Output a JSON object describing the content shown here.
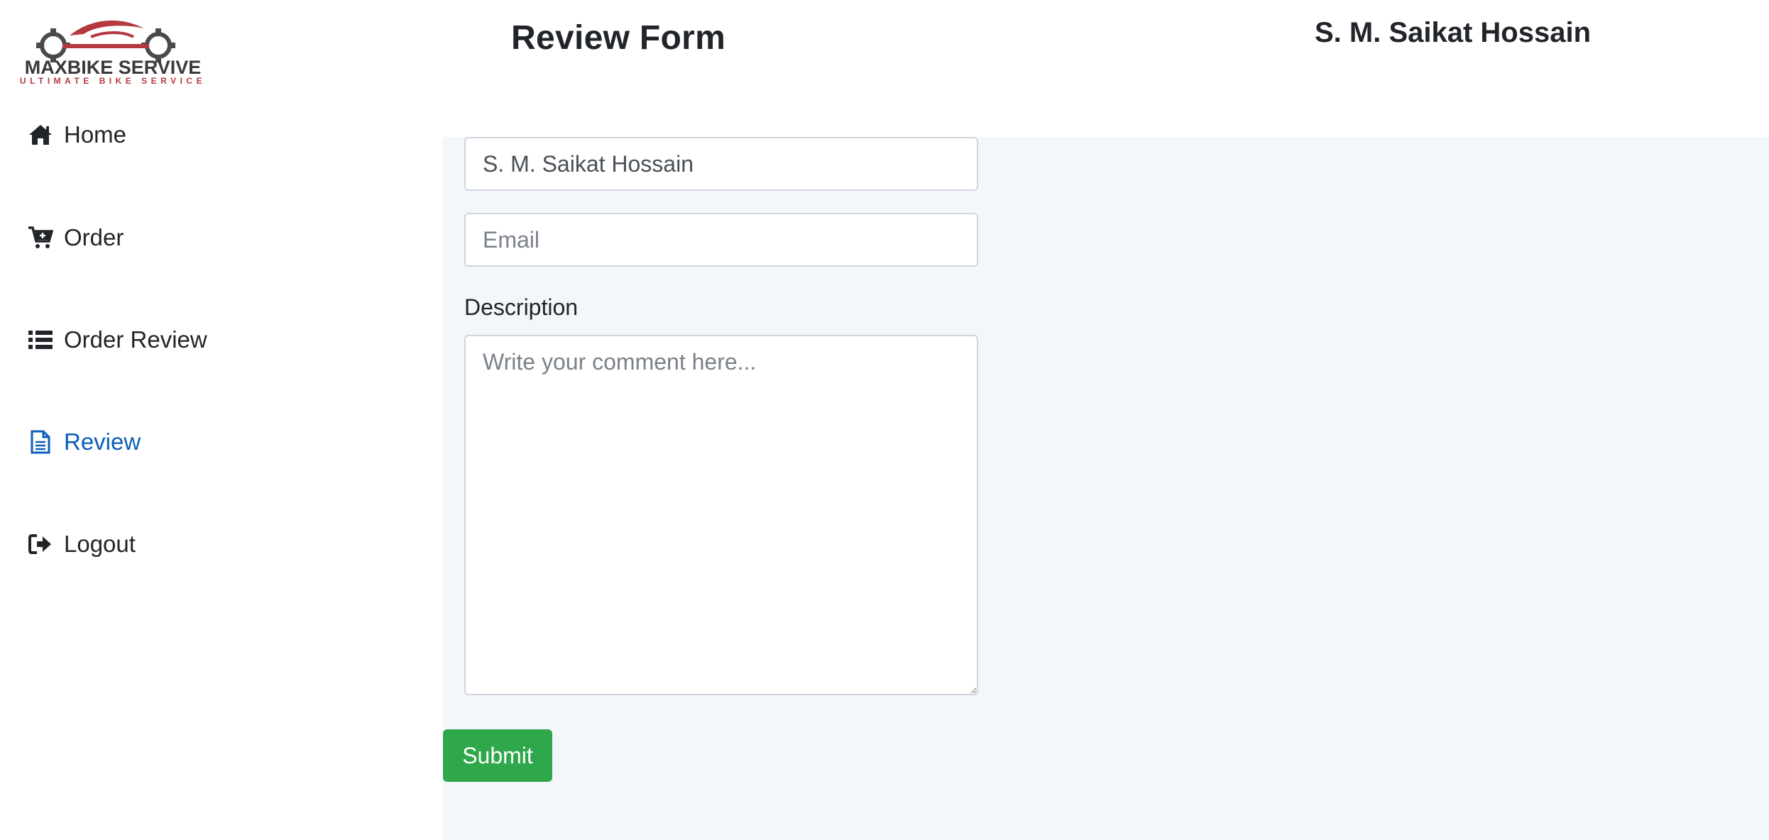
{
  "brand": {
    "name": "MAXBIKE SERVIVE",
    "tagline": "ULTIMATE BIKE SERVICE"
  },
  "header": {
    "title": "Review Form",
    "user_name": "S. M. Saikat Hossain"
  },
  "sidebar": {
    "items": [
      {
        "label": "Home",
        "icon": "home-icon",
        "active": false
      },
      {
        "label": "Order",
        "icon": "cart-plus-icon",
        "active": false
      },
      {
        "label": "Order Review",
        "icon": "list-icon",
        "active": false
      },
      {
        "label": "Review",
        "icon": "file-text-icon",
        "active": true
      },
      {
        "label": "Logout",
        "icon": "sign-out-icon",
        "active": false
      }
    ]
  },
  "form": {
    "name_value": "S. M. Saikat Hossain",
    "email_placeholder": "Email",
    "description_label": "Description",
    "comment_placeholder": "Write your comment here...",
    "submit_label": "Submit"
  },
  "colors": {
    "active_nav": "#0d5eb8",
    "submit": "#2ea84a",
    "main_background": "#f3f6fa",
    "brand_red": "#b5383f"
  }
}
